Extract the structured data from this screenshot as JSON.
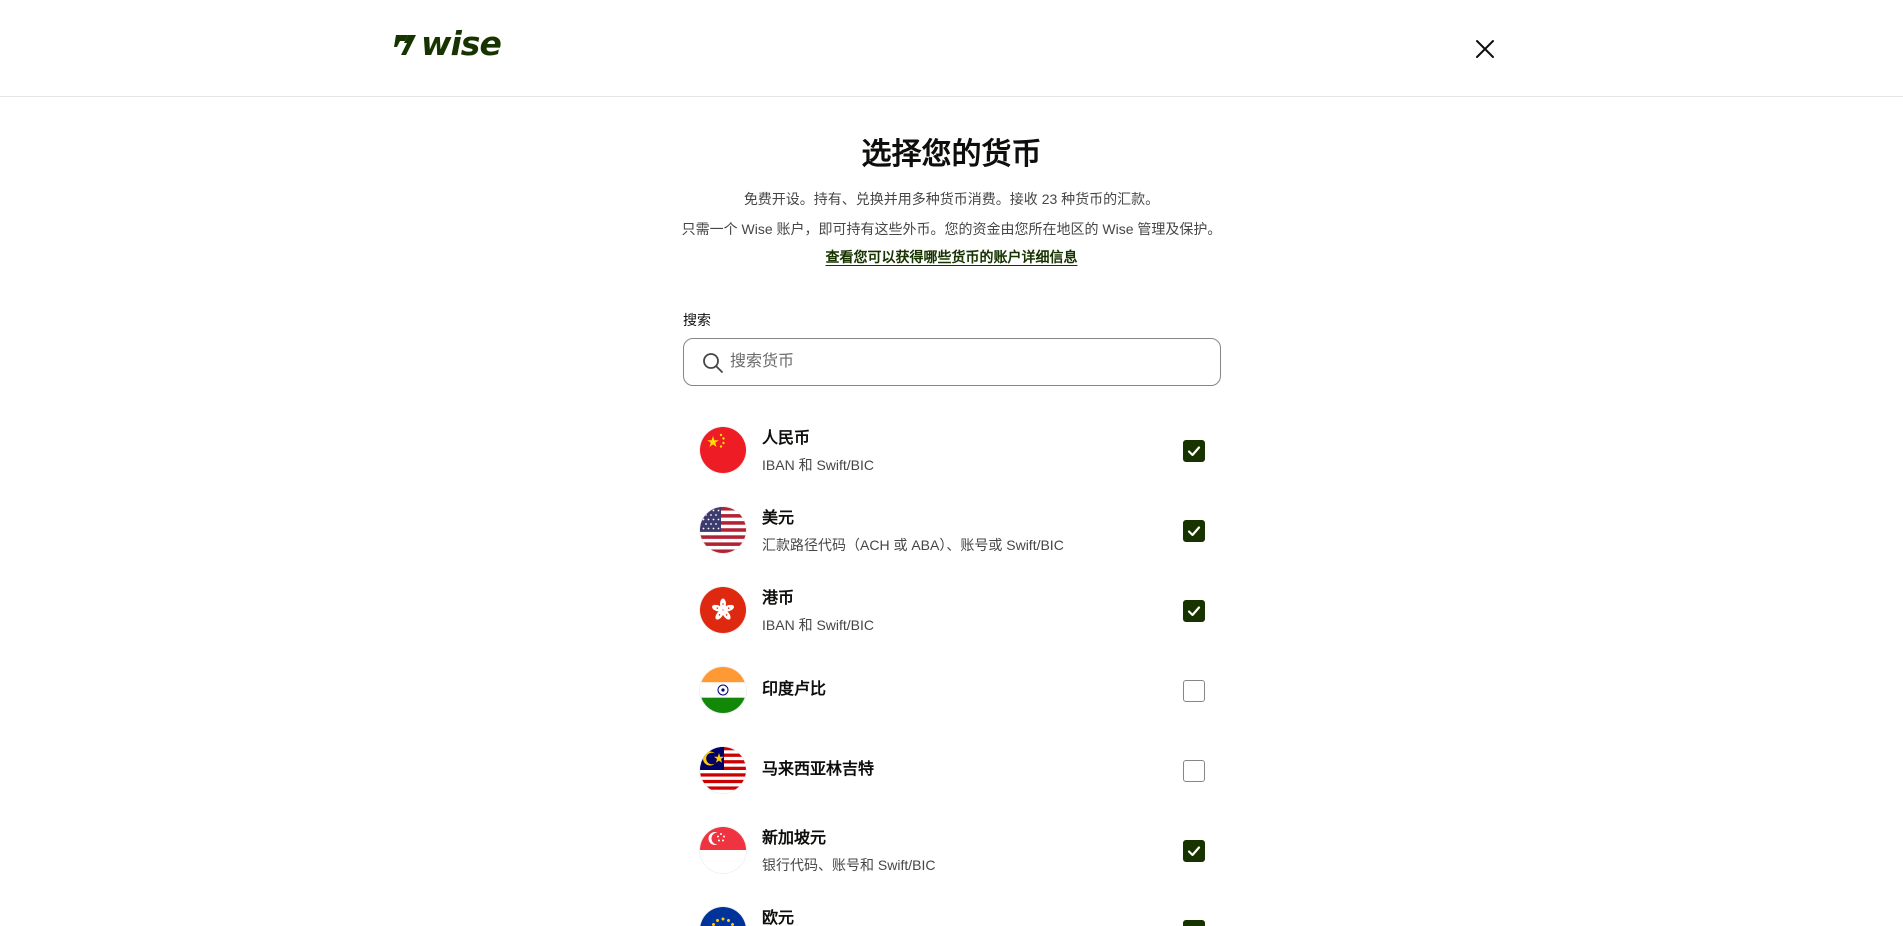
{
  "header": {
    "logo_text": "wise",
    "close_icon": "close-icon"
  },
  "main": {
    "title": "选择您的货币",
    "subtitle_line1": "免费开设。持有、兑换并用多种货币消费。接收 23 种货币的汇款。",
    "subtitle_line2": "只需一个 Wise 账户，即可持有这些外币。您的资金由您所在地区的 Wise 管理及保护。",
    "details_link": "查看您可以获得哪些货币的账户详细信息"
  },
  "search": {
    "label": "搜索",
    "placeholder": "搜索货币",
    "value": ""
  },
  "currencies": [
    {
      "flag": "cn-flag-icon",
      "name": "人民币",
      "desc": "IBAN 和 Swift/BIC",
      "checked": true
    },
    {
      "flag": "us-flag-icon",
      "name": "美元",
      "desc": "汇款路径代码（ACH 或 ABA）、账号或 Swift/BIC",
      "checked": true
    },
    {
      "flag": "hk-flag-icon",
      "name": "港币",
      "desc": "IBAN 和 Swift/BIC",
      "checked": true
    },
    {
      "flag": "in-flag-icon",
      "name": "印度卢比",
      "desc": "",
      "checked": false
    },
    {
      "flag": "my-flag-icon",
      "name": "马来西亚林吉特",
      "desc": "",
      "checked": false
    },
    {
      "flag": "sg-flag-icon",
      "name": "新加坡元",
      "desc": "银行代码、账号和 Swift/BIC",
      "checked": true
    },
    {
      "flag": "eu-flag-icon",
      "name": "欧元",
      "desc": "",
      "checked": true
    }
  ],
  "colors": {
    "brand_green": "#163300",
    "text_primary": "#0e0f0c",
    "text_secondary": "#454745"
  }
}
